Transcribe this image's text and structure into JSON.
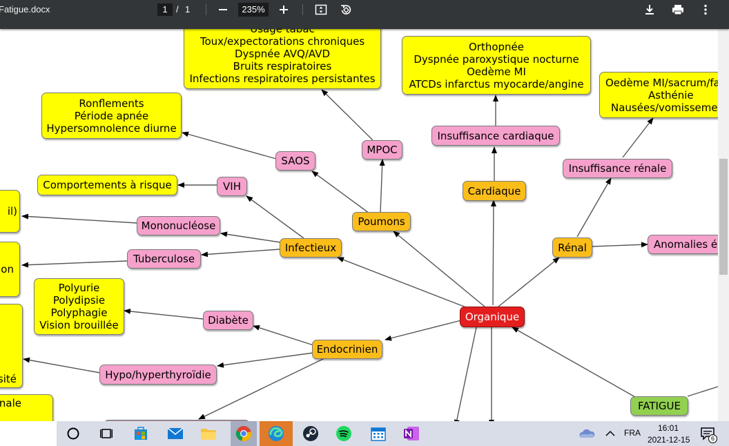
{
  "toolbar": {
    "doc_title": "Fatigue.docx",
    "page_current": "1",
    "page_separator": "/",
    "page_total": "1",
    "zoom": "235%",
    "icons": [
      "minus-icon",
      "plus-icon",
      "fit-page-icon",
      "rotate-icon",
      "download-icon",
      "print-icon",
      "more-vert-icon"
    ]
  },
  "mindmap": {
    "nodes": {
      "copd_symptoms": [
        "Usage tabac",
        "Toux/expectorations chroniques",
        "Dyspnée AVQ/AVD",
        "Bruits respiratoires",
        "Infections respiratoires persistantes"
      ],
      "heart_symptoms": [
        "Orthopnée",
        "Dyspnée paroxystique nocturne",
        "Oedème MI",
        "ATCDs infarctus myocarde/angine"
      ],
      "renal_symptoms": [
        "Oedème MI/sacrum/fa",
        "Asthénie",
        "Nausées/vomisseme"
      ],
      "osa_symptoms": [
        "Ronflements",
        "Période apnée",
        "Hypersomnolence diurne"
      ],
      "risk": "Comportements à risque",
      "diabetes_symptoms": [
        "Polyurie",
        "Polydipsie",
        "Polyphagie",
        "Vision brouillée"
      ],
      "left_box_1": "il)",
      "left_box_2": "ion",
      "left_box_3": "sité",
      "left_box_4": "nale",
      "saos": "SAOS",
      "mpoc": "MPOC",
      "insuf_card": "Insuffisance cardiaque",
      "insuf_renal": "Insuffisance rénale",
      "vih": "VIH",
      "mono": "Mononucléose",
      "tb": "Tuberculose",
      "diabete": "Diabète",
      "thyroid": "Hypo/hyperthyroïdie",
      "anomalies": "Anomalies é",
      "cardiaque": "Cardiaque",
      "poumons": "Poumons",
      "infectieux": "Infectieux",
      "renal": "Rénal",
      "endocrinien": "Endocrinien",
      "organique": "Organique",
      "fatigue": "FATIGUE"
    }
  },
  "taskbar": {
    "apps": [
      "cortana-circle-icon",
      "task-view-icon",
      "store-icon",
      "mail-icon",
      "file-explorer-icon",
      "chrome-icon",
      "edge-icon",
      "steam-icon",
      "spotify-icon",
      "calendar-icon",
      "onenote-icon"
    ],
    "language": "FRA",
    "time": "16:01",
    "date": "2021-12-15",
    "notification_count": "6"
  },
  "colors": {
    "toolbar_bg": "#323639",
    "yellow": "#ffff00",
    "pink": "#f5a1cc",
    "orange": "#fbbd1a",
    "red": "#e41e1e",
    "green": "#92d050"
  }
}
